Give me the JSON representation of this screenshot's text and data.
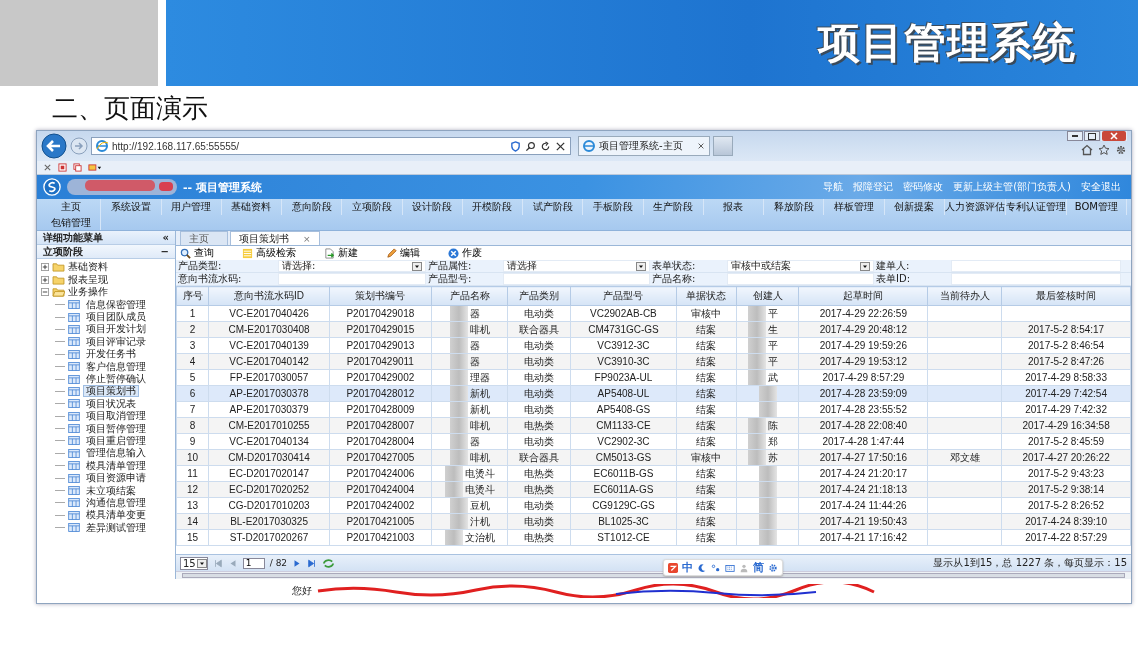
{
  "slide": {
    "banner_title": "项目管理系统",
    "heading": "二、页面演示"
  },
  "browser": {
    "address": "http://192.168.117.65:55555/",
    "tab_title": "项目管理系统-主页"
  },
  "app": {
    "title": "-- 项目管理系统",
    "header_links": [
      "导航",
      "报障登记",
      "密码修改",
      "更新上级主管(部门负责人)",
      "安全退出"
    ],
    "nav": [
      "主页",
      "系统设置",
      "用户管理",
      "基础资料",
      "意向阶段",
      "立项阶段",
      "设计阶段",
      "开模阶段",
      "试产阶段",
      "手板阶段",
      "生产阶段",
      "报表",
      "释放阶段",
      "样板管理",
      "创新提案",
      "人力资源评估",
      "专利认证管理",
      "BOM管理",
      "包销管理"
    ],
    "sidebar": {
      "title": "详细功能菜单",
      "collapse_icon": "«",
      "section": "立项阶段",
      "section_toggle": "−",
      "tree": [
        {
          "label": "基础资料",
          "expanded": false
        },
        {
          "label": "报表呈现",
          "expanded": false
        },
        {
          "label": "业务操作",
          "expanded": true,
          "children": [
            {
              "label": "信息保密管理",
              "selected": false
            },
            {
              "label": "项目团队成员",
              "selected": false
            },
            {
              "label": "项目开发计划",
              "selected": false
            },
            {
              "label": "项目评审记录",
              "selected": false
            },
            {
              "label": "开发任务书",
              "selected": false
            },
            {
              "label": "客户信息管理",
              "selected": false
            },
            {
              "label": "停止暂停确认",
              "selected": false
            },
            {
              "label": "项目策划书",
              "selected": true
            },
            {
              "label": "项目状况表",
              "selected": false
            },
            {
              "label": "项目取消管理",
              "selected": false
            },
            {
              "label": "项目暂停管理",
              "selected": false
            },
            {
              "label": "项目重启管理",
              "selected": false
            },
            {
              "label": "管理信息输入",
              "selected": false
            },
            {
              "label": "模具清单管理",
              "selected": false
            },
            {
              "label": "项目资源申请",
              "selected": false
            },
            {
              "label": "未立项结案",
              "selected": false
            },
            {
              "label": "沟通信息管理",
              "selected": false
            },
            {
              "label": "模具清单变更",
              "selected": false
            },
            {
              "label": "差异测试管理",
              "selected": false
            }
          ]
        }
      ]
    },
    "tabs": [
      {
        "label": "主页",
        "selected": false,
        "closable": false
      },
      {
        "label": "项目策划书",
        "selected": true,
        "closable": true
      }
    ],
    "close_glyph": "×",
    "toolbar": [
      {
        "kind": "search",
        "label": "查询"
      },
      {
        "kind": "advanced",
        "label": "高级检索"
      },
      {
        "kind": "new",
        "label": "新建"
      },
      {
        "kind": "edit",
        "label": "编辑"
      },
      {
        "kind": "void",
        "label": "作废"
      }
    ],
    "filters": [
      [
        {
          "label": "产品类型:",
          "value": "请选择:",
          "dropdown": true
        },
        {
          "label": "产品属性:",
          "value": "请选择",
          "dropdown": true
        },
        {
          "label": "表单状态:",
          "value": "审核中或结案",
          "dropdown": true
        },
        {
          "label": "建单人:",
          "dropdown": false
        }
      ],
      [
        {
          "label": "意向书流水码:",
          "dropdown": false
        },
        {
          "label": "产品型号:",
          "dropdown": false
        },
        {
          "label": "产品名称:",
          "dropdown": false
        },
        {
          "label": "表单ID:",
          "dropdown": false
        }
      ]
    ],
    "table": {
      "columns": [
        {
          "label": "序号",
          "blurred": false
        },
        {
          "label": "意向书流水码ID",
          "blurred": false
        },
        {
          "label": "策划书编号",
          "blurred": false
        },
        {
          "label": "产品名称",
          "blurred": true
        },
        {
          "label": "产品类别",
          "blurred": false
        },
        {
          "label": "产品型号",
          "blurred": false
        },
        {
          "label": "单据状态",
          "blurred": false
        },
        {
          "label": "创建人",
          "blurred": true
        },
        {
          "label": "起草时间",
          "blurred": false
        },
        {
          "label": "当前待办人",
          "blurred": false
        },
        {
          "label": "最后签核时间",
          "blurred": false
        }
      ],
      "rows": [
        {
          "no": "1",
          "intent": "VC-E2017040426",
          "plan": "P20170429018",
          "name": "器",
          "category": "电动类",
          "model": "VC2902AB-CB",
          "status": "审核中",
          "creator": "平",
          "drafted": "2017-4-29 22:26:59",
          "selected": false
        },
        {
          "no": "2",
          "intent": "CM-E2017030408",
          "plan": "P20170429015",
          "name": "啡机",
          "category": "联合器具",
          "model": "CM4731GC-GS",
          "status": "结案",
          "creator": "生",
          "drafted": "2017-4-29 20:48:12",
          "signed": "2017-5-2 8:54:17",
          "selected": false
        },
        {
          "no": "3",
          "intent": "VC-E2017040139",
          "plan": "P20170429013",
          "name": "器",
          "category": "电动类",
          "model": "VC3912-3C",
          "status": "结案",
          "creator": "平",
          "drafted": "2017-4-29 19:59:26",
          "signed": "2017-5-2 8:46:54",
          "selected": false
        },
        {
          "no": "4",
          "intent": "VC-E2017040142",
          "plan": "P20170429011",
          "name": "器",
          "category": "电动类",
          "model": "VC3910-3C",
          "status": "结案",
          "creator": "平",
          "drafted": "2017-4-29 19:53:12",
          "signed": "2017-5-2 8:47:26",
          "selected": false
        },
        {
          "no": "5",
          "intent": "FP-E2017030057",
          "plan": "P20170429002",
          "name": "理器",
          "category": "电动类",
          "model": "FP9023A-UL",
          "status": "结案",
          "creator": "武",
          "drafted": "2017-4-29 8:57:29",
          "signed": "2017-4-29 8:58:33",
          "selected": false
        },
        {
          "no": "6",
          "intent": "AP-E2017030378",
          "plan": "P20170428012",
          "name": "新机",
          "category": "电动类",
          "model": "AP5408-UL",
          "status": "结案",
          "drafted": "2017-4-28 23:59:09",
          "signed": "2017-4-29 7:42:54",
          "selected": true
        },
        {
          "no": "7",
          "intent": "AP-E2017030379",
          "plan": "P20170428009",
          "name": "新机",
          "category": "电动类",
          "model": "AP5408-GS",
          "status": "结案",
          "drafted": "2017-4-28 23:55:52",
          "signed": "2017-4-29 7:42:32",
          "selected": false
        },
        {
          "no": "8",
          "intent": "CM-E2017010255",
          "plan": "P20170428007",
          "name": "啡机",
          "category": "电热类",
          "model": "CM1133-CE",
          "status": "结案",
          "creator": "陈",
          "drafted": "2017-4-28 22:08:40",
          "signed": "2017-4-29 16:34:58",
          "selected": false
        },
        {
          "no": "9",
          "intent": "VC-E2017040134",
          "plan": "P20170428004",
          "name": "器",
          "category": "电动类",
          "model": "VC2902-3C",
          "status": "结案",
          "creator": "郑",
          "drafted": "2017-4-28 1:47:44",
          "signed": "2017-5-2 8:45:59",
          "selected": false
        },
        {
          "no": "10",
          "intent": "CM-D2017030414",
          "plan": "P20170427005",
          "name": "啡机",
          "category": "联合器具",
          "model": "CM5013-GS",
          "status": "审核中",
          "creator": "苏",
          "drafted": "2017-4-27 17:50:16",
          "pending": "邓文雄",
          "signed": "2017-4-27 20:26:22",
          "selected": false
        },
        {
          "no": "11",
          "intent": "EC-D2017020147",
          "plan": "P20170424006",
          "name": "电烫斗",
          "category": "电热类",
          "model": "EC6011B-GS",
          "status": "结案",
          "drafted": "2017-4-24 21:20:17",
          "signed": "2017-5-2 9:43:23",
          "selected": false
        },
        {
          "no": "12",
          "intent": "EC-D2017020252",
          "plan": "P20170424004",
          "name": "电烫斗",
          "category": "电热类",
          "model": "EC6011A-GS",
          "status": "结案",
          "drafted": "2017-4-24 21:18:13",
          "signed": "2017-5-2 9:38:14",
          "selected": false
        },
        {
          "no": "13",
          "intent": "CG-D2017010203",
          "plan": "P20170424002",
          "name": "豆机",
          "category": "电动类",
          "model": "CG9129C-GS",
          "status": "结案",
          "drafted": "2017-4-24 11:44:26",
          "signed": "2017-5-2 8:26:52",
          "selected": false
        },
        {
          "no": "14",
          "intent": "BL-E2017030325",
          "plan": "P20170421005",
          "name": "汁机",
          "category": "电动类",
          "model": "BL1025-3C",
          "status": "结案",
          "drafted": "2017-4-21 19:50:43",
          "signed": "2017-4-24 8:39:10",
          "selected": false
        },
        {
          "no": "15",
          "intent": "ST-D2017020267",
          "plan": "P20170421003",
          "name": "文治机",
          "category": "电热类",
          "model": "ST1012-CE",
          "status": "结案",
          "drafted": "2017-4-21 17:16:42",
          "signed": "2017-4-22 8:57:29",
          "selected": false
        }
      ]
    },
    "pager": {
      "page_size": "15",
      "page": "1",
      "total_pages": "/ 82",
      "summary": "显示从1到15，总 1227 条，每页显示：15"
    },
    "ime": {
      "mode": "中",
      "script": "简"
    },
    "footer": {
      "greeting": "您好"
    }
  }
}
